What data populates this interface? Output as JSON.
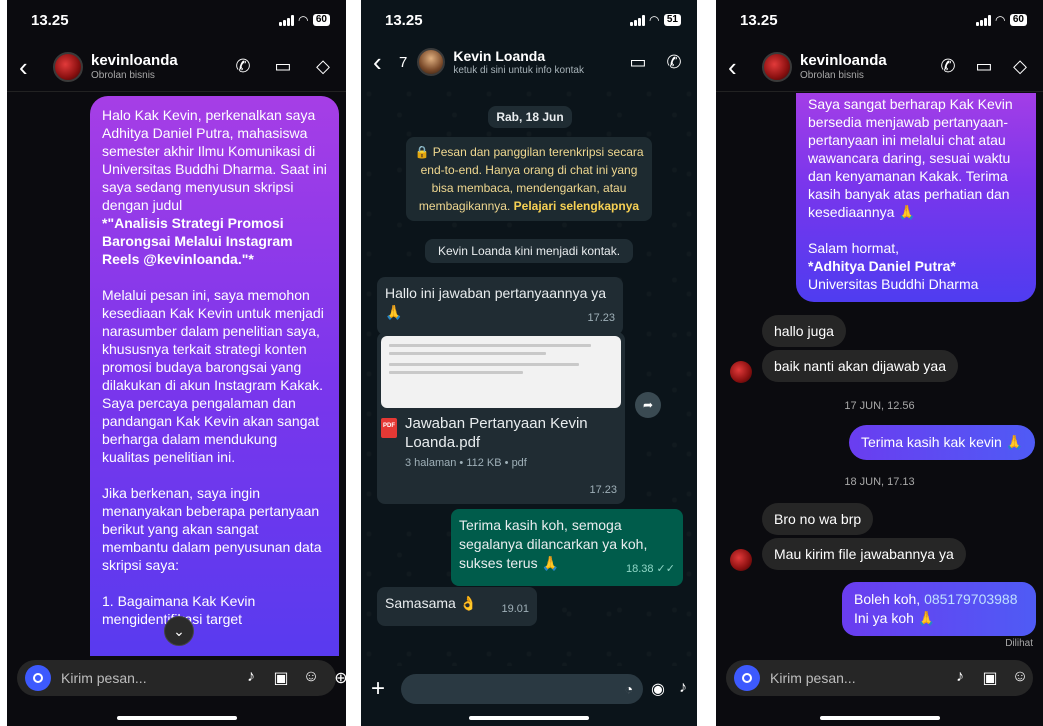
{
  "panel1": {
    "status_time": "13.25",
    "battery": "60",
    "header": {
      "name": "kevinloanda",
      "subtitle": "Obrolan bisnis"
    },
    "message_paragraphs": [
      "Halo Kak Kevin, perkenalkan saya Adhitya Daniel Putra, mahasiswa semester akhir Ilmu Komunikasi di Universitas Buddhi Dharma. Saat ini saya sedang menyusun skripsi dengan judul",
      "*\"Analisis Strategi Promosi Barongsai Melalui Instagram Reels @kevinloanda.\"*",
      "Melalui pesan ini, saya memohon kesediaan Kak Kevin untuk menjadi narasumber dalam penelitian saya, khususnya terkait strategi konten promosi budaya barongsai yang dilakukan di akun Instagram Kakak. Saya percaya pengalaman dan pandangan Kak Kevin akan sangat berharga dalam mendukung kualitas penelitian ini.",
      "Jika berkenan, saya ingin menanyakan beberapa pertanyaan berikut yang akan sangat membantu dalam penyusunan data skripsi saya:",
      "1. Bagaimana Kak Kevin mengidentifikasi target"
    ],
    "composer_placeholder": "Kirim pesan..."
  },
  "panel2": {
    "status_time": "13.25",
    "battery": "51",
    "header": {
      "back_count": "7",
      "name": "Kevin Loanda",
      "subtitle": "ketuk di sini untuk info kontak"
    },
    "date_pill": "Rab, 18 Jun",
    "encryption_notice": "🔒 Pesan dan panggilan terenkripsi secara end-to-end. Hanya orang di chat ini yang bisa membaca, mendengarkan, atau membagikannya.",
    "encryption_link": "Pelajari selengkapnya",
    "contact_notice": "Kevin Loanda kini menjadi kontak.",
    "msg1": {
      "text": "Hallo ini jawaban pertanyaannya ya 🙏",
      "time": "17.23"
    },
    "doc": {
      "preview_line": "1. Bagaimana Kak Kevin mengidentifikasi target audiens utama untuk konten barongsai yang dipublikasikan melalui Instagram Reels akun @kevinloanda?",
      "preview_bullet": "• Target audiens yang saya tuju adalah anggota2 dari perkumpulan barongsai di",
      "name": "Jawaban Pertanyaan Kevin Loanda.pdf",
      "meta": "3 halaman • 112 KB • pdf",
      "time": "17.23",
      "badge": "PDF"
    },
    "msg2": {
      "text": "Terima kasih koh, semoga segalanya dilancarkan ya koh, sukses terus 🙏",
      "time": "18.38 ✓✓"
    },
    "msg3": {
      "text": "Samasama 👌",
      "time": "19.01"
    }
  },
  "panel3": {
    "status_time": "13.25",
    "battery": "60",
    "header": {
      "name": "kevinloanda",
      "subtitle": "Obrolan bisnis"
    },
    "out_paragraphs": [
      "Saya sangat berharap Kak Kevin bersedia menjawab pertanyaan-pertanyaan ini melalui chat atau wawancara daring, sesuai waktu dan kenyamanan Kakak. Terima kasih banyak atas perhatian dan kesediaannya 🙏",
      "Salam hormat,",
      "*Adhitya Daniel Putra*",
      "Universitas Buddhi Dharma"
    ],
    "in1": "hallo juga",
    "in2": "baik nanti akan dijawab yaa",
    "stamp1": "17 JUN, 12.56",
    "out1": "Terima kasih kak kevin 🙏",
    "stamp2": "18 JUN, 17.13",
    "in3": "Bro no wa brp",
    "in4": "Mau kirim file jawabannya ya",
    "out2_prefix": "Boleh koh, ",
    "out2_phone": "085179703988",
    "out2_suffix": "Ini ya koh 🙏",
    "seen": "Dilihat",
    "composer_placeholder": "Kirim pesan..."
  },
  "colors": {
    "ig_gradient_top": "#a63ee6",
    "ig_gradient_bottom": "#4f3cf0",
    "wa_out": "#005c4b",
    "wa_in": "#202c33",
    "link_yellow": "#f7d154"
  }
}
